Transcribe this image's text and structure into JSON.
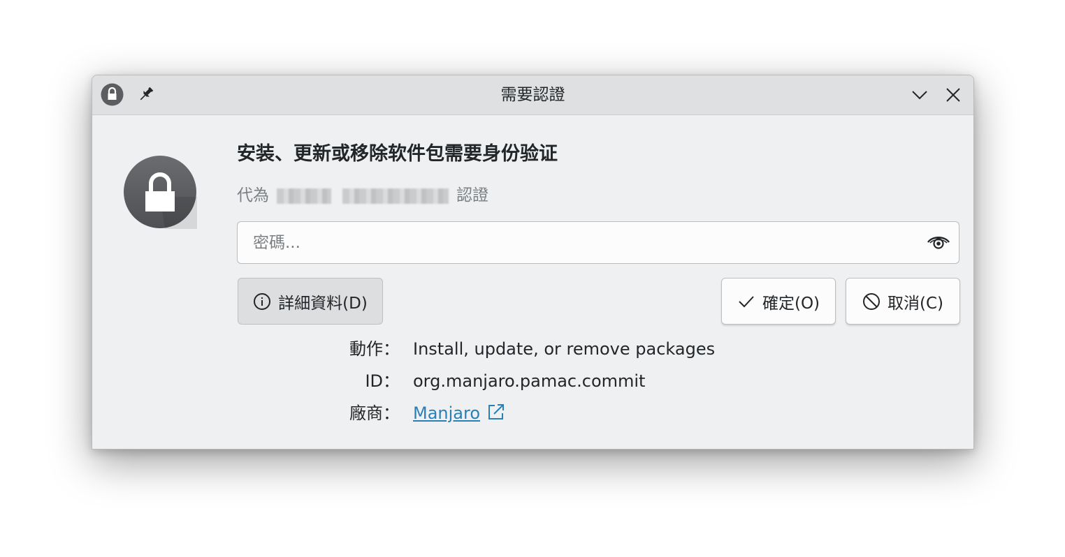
{
  "window": {
    "title": "需要認證"
  },
  "titlebar": {
    "lock_icon": "lock-icon",
    "pin_icon": "pin-icon",
    "minimize_icon": "chevron-down-icon",
    "close_icon": "close-icon"
  },
  "auth": {
    "heading": "安装、更新或移除软件包需要身份验证",
    "subline_prefix": "代為",
    "subline_suffix": "認證",
    "password_placeholder": "密碼..."
  },
  "buttons": {
    "details_label": "詳細資料(D)",
    "ok_label": "確定(O)",
    "cancel_label": "取消(C)"
  },
  "details": {
    "action_key": "動作：",
    "action_value": "Install, update, or remove packages",
    "id_key": "ID：",
    "id_value": "org.manjaro.pamac.commit",
    "vendor_key": "廠商：",
    "vendor_value": "Manjaro"
  },
  "colors": {
    "window_bg": "#eff0f1",
    "titlebar_bg": "#dee0e2",
    "link": "#2980b9",
    "text": "#232629",
    "muted_text": "#7b7f83"
  }
}
